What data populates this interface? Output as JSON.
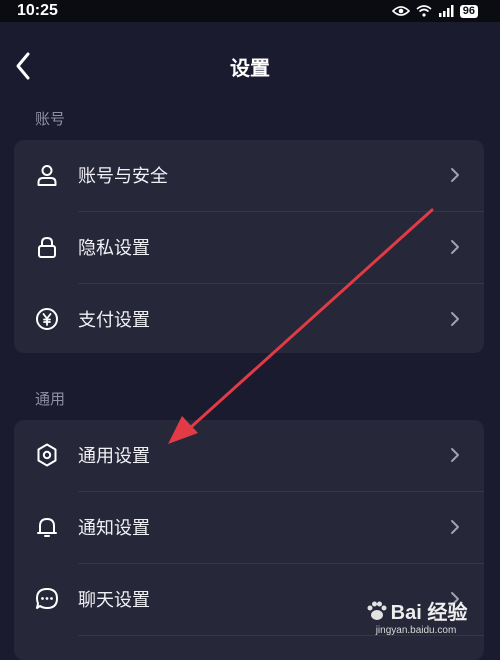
{
  "status_bar": {
    "time": "10:25",
    "battery": "96",
    "icons": [
      "eye-icon",
      "wifi-icon",
      "signal-icon",
      "battery-icon"
    ]
  },
  "nav": {
    "title": "设置",
    "back_icon": "back-arrow-icon"
  },
  "sections": {
    "account": {
      "header": "账号",
      "items": [
        {
          "label": "账号与安全",
          "icon": "user-icon"
        },
        {
          "label": "隐私设置",
          "icon": "lock-icon"
        },
        {
          "label": "支付设置",
          "icon": "yen-icon"
        }
      ]
    },
    "general": {
      "header": "通用",
      "items": [
        {
          "label": "通用设置",
          "icon": "gear-icon"
        },
        {
          "label": "通知设置",
          "icon": "bell-icon"
        },
        {
          "label": "聊天设置",
          "icon": "chat-icon"
        }
      ]
    }
  },
  "colors": {
    "background": "#1a1b2e",
    "card": "#262739",
    "accent_arrow": "#e23b45"
  },
  "watermark": {
    "text": "Bai 经验",
    "url": "jingyan.baidu.com"
  }
}
